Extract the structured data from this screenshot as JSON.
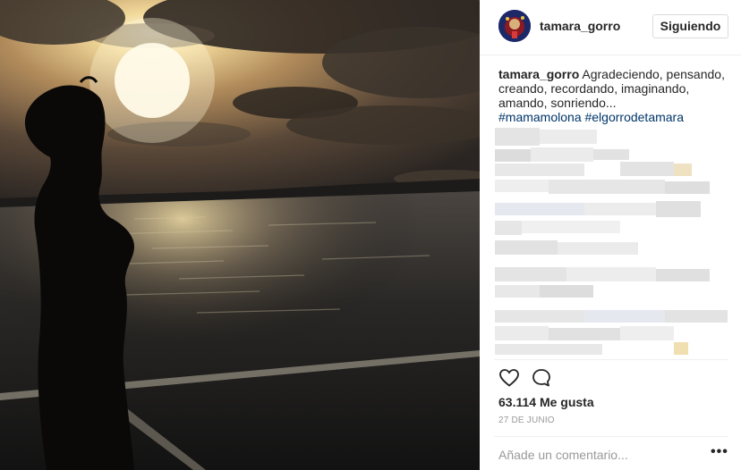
{
  "post": {
    "username": "tamara_gorro",
    "follow_label": "Siguiendo",
    "caption_user": "tamara_gorro",
    "caption_text": " Agradeciendo, pensando, creando, recordando, imaginando, amando, sonriendo...",
    "hashtags": "#mamamolona #elgorrodetamara",
    "likes": "63.114 Me gusta",
    "date": "27 DE JUNIO",
    "comment_placeholder": "Añade un comentario...",
    "more_label": "•••"
  },
  "icons": {
    "like": "heart-icon",
    "comment": "speech-bubble-icon",
    "options": "more-options-icon"
  },
  "colors": {
    "hashtag": "#003569",
    "text": "#262626",
    "muted": "#999999",
    "border": "#dbdbdb"
  }
}
